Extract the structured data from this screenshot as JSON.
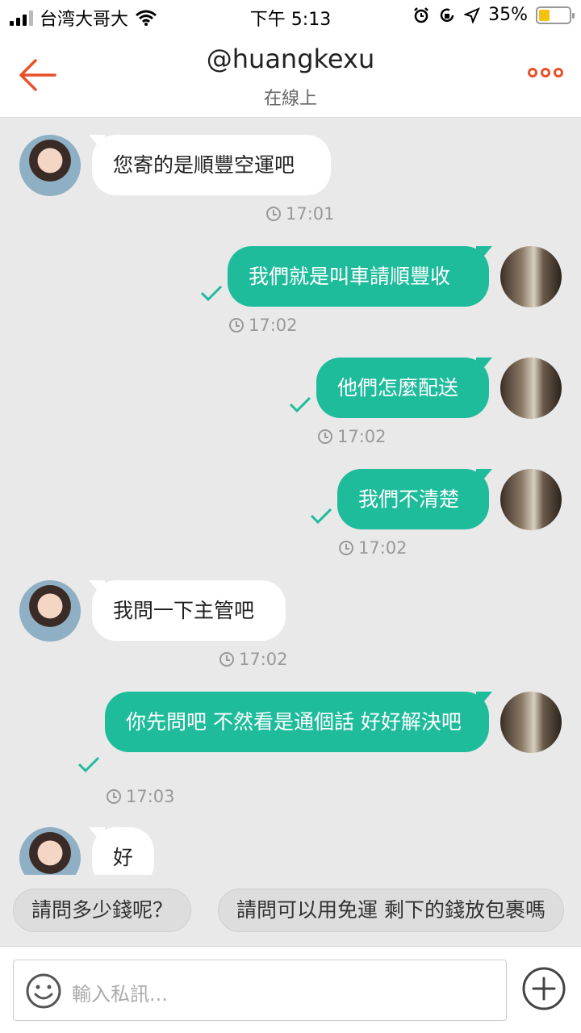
{
  "status_bar": {
    "carrier": "台湾大哥大",
    "time": "下午 5:13",
    "battery_text": "35%",
    "battery_level": 0.35,
    "icons": [
      "signal-icon",
      "wifi-icon",
      "alarm-icon",
      "lock-rotation-icon",
      "location-icon",
      "battery-icon"
    ]
  },
  "header": {
    "title": "@huangkexu",
    "subtitle": "在線上",
    "back_icon": "arrow-left-icon",
    "more_icon": "more-dots-icon",
    "accent_color": "#e8512a"
  },
  "messages": [
    {
      "from": "them",
      "text": "您寄的是順豐空運吧",
      "time": "17:01"
    },
    {
      "from": "me",
      "text": "我們就是叫車請順豐收",
      "time": "17:02",
      "read": true
    },
    {
      "from": "me",
      "text": "他們怎麼配送",
      "time": "17:02",
      "read": true
    },
    {
      "from": "me",
      "text": "我們不清楚",
      "time": "17:02",
      "read": true
    },
    {
      "from": "them",
      "text": "我問一下主管吧",
      "time": "17:02"
    },
    {
      "from": "me",
      "text": "你先問吧 不然看是通個話 好好解決吧",
      "time": "17:03",
      "read": true
    },
    {
      "from": "them",
      "text": "好",
      "time": ""
    }
  ],
  "quick_replies": [
    "請問多少錢呢？",
    "請問可以用免運 剩下的錢放包裹嗎"
  ],
  "input": {
    "placeholder": "輸入私訊...",
    "emoji_icon": "smiley-icon",
    "plus_icon": "plus-circle-icon"
  },
  "colors": {
    "outgoing_bubble": "#1fbc9c",
    "incoming_bubble": "#ffffff",
    "background": "#e9e9e9"
  }
}
